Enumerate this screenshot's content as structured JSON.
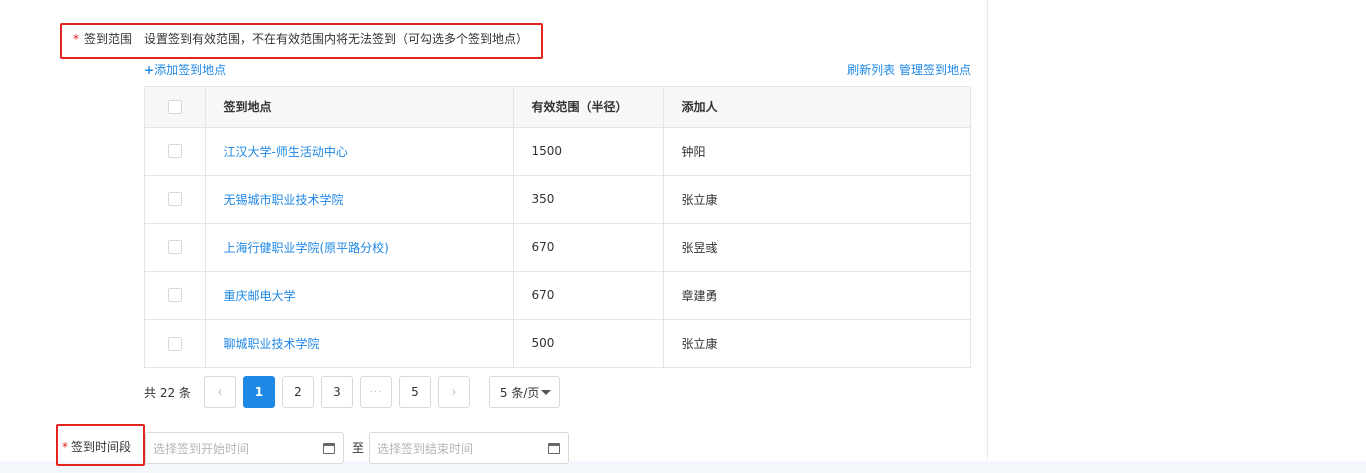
{
  "range": {
    "label": "签到范围",
    "hint": "设置签到有效范围，不在有效范围内将无法签到（可勾选多个签到地点）",
    "required_mark": "*"
  },
  "toolbar": {
    "add_icon": "+",
    "add_label": "添加签到地点",
    "refresh_label": "刷新列表",
    "manage_label": "管理签到地点"
  },
  "table": {
    "headers": [
      "签到地点",
      "有效范围（半径）",
      "添加人"
    ],
    "rows": [
      {
        "location": "江汉大学-师生活动中心",
        "range": "1500",
        "creator": "钟阳"
      },
      {
        "location": "无锡城市职业技术学院",
        "range": "350",
        "creator": "张立康"
      },
      {
        "location": "上海行健职业学院(原平路分校)",
        "range": "670",
        "creator": "张昱彧"
      },
      {
        "location": "重庆邮电大学",
        "range": "670",
        "creator": "章建勇"
      },
      {
        "location": "聊城职业技术学院",
        "range": "500",
        "creator": "张立康"
      }
    ]
  },
  "pagination": {
    "total": "共 22 条",
    "prev_icon": "‹",
    "next_icon": "›",
    "pages": [
      "1",
      "2",
      "3",
      "5"
    ],
    "ellipsis": "···",
    "current": "1",
    "page_size": "5 条/页"
  },
  "time": {
    "label": "签到时间段",
    "required_mark": "*",
    "start_placeholder": "选择签到开始时间",
    "to": "至",
    "end_placeholder": "选择签到结束时间"
  },
  "colors": {
    "accent": "#1e88e5",
    "required": "#e3231f",
    "highlight_border": "#e3231f"
  }
}
